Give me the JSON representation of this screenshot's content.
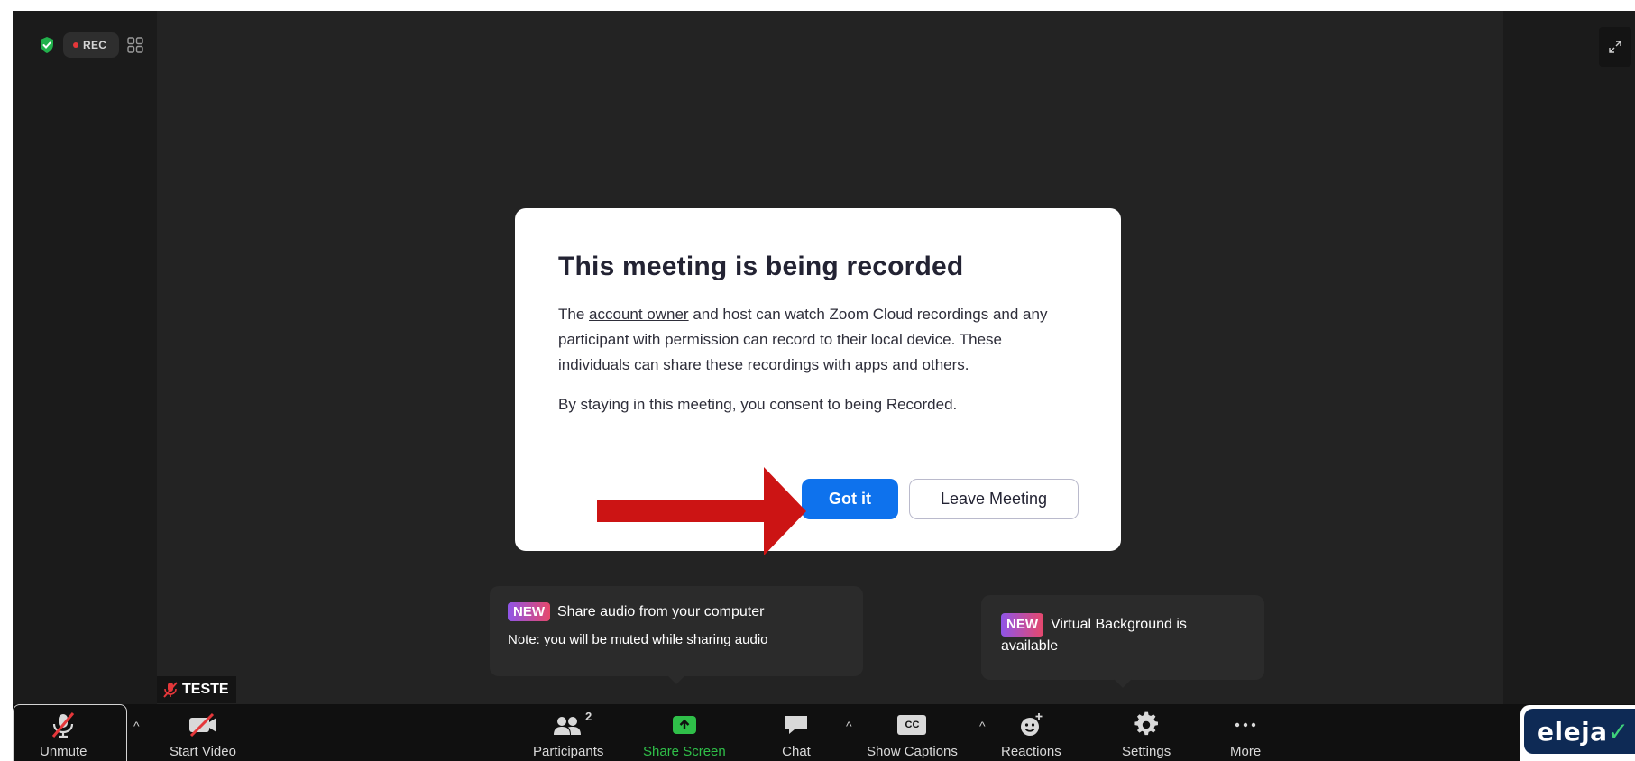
{
  "top_left": {
    "rec_label": "REC"
  },
  "dialog": {
    "title": "This meeting is being recorded",
    "para1_pre": "The ",
    "para1_link": "account owner",
    "para1_post": " and host can watch Zoom Cloud recordings and any participant with permission can record to their local device. These individuals can share these recordings with apps and others.",
    "para2": "By staying in this meeting, you consent to being Recorded.",
    "got_it": "Got it",
    "leave": "Leave Meeting"
  },
  "tooltips": {
    "audio": {
      "badge": "NEW",
      "line1": "Share audio from your computer",
      "line2": "Note: you will be muted while sharing audio"
    },
    "virtual_bg": {
      "badge": "NEW",
      "text": "Virtual Background is available"
    }
  },
  "name_tag": {
    "name": "TESTE"
  },
  "toolbar": {
    "unmute": "Unmute",
    "start_video": "Start Video",
    "participants": "Participants",
    "participants_count": "2",
    "share_screen": "Share Screen",
    "chat": "Chat",
    "show_captions": "Show Captions",
    "cc": "CC",
    "reactions": "Reactions",
    "settings": "Settings",
    "more": "More"
  },
  "brand": {
    "text": "eleja"
  },
  "colors": {
    "accent_blue": "#0e72ed",
    "rec_red": "#e5373a",
    "share_green": "#2fbf49",
    "annotation_arrow": "#cc1414"
  }
}
